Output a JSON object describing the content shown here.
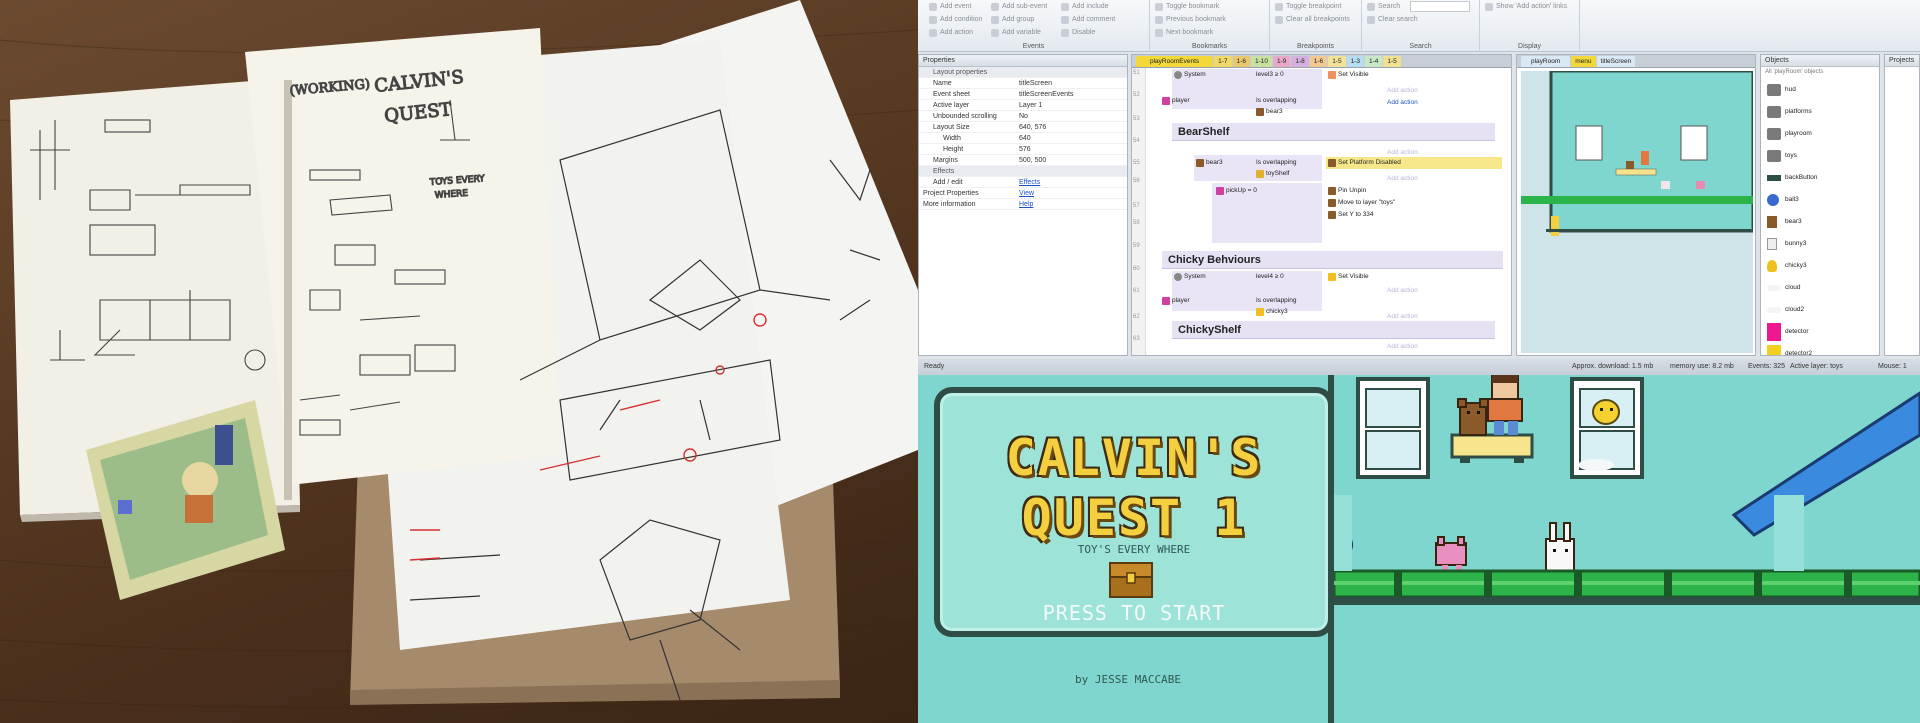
{
  "ribbon": {
    "groups": [
      {
        "label": "Events",
        "buttons": [
          "Add event",
          "Add condition",
          "Add action",
          "Add sub-event",
          "Add group",
          "Add variable",
          "Add include",
          "Add comment",
          "Disable"
        ]
      },
      {
        "label": "Bookmarks",
        "buttons": [
          "Toggle bookmark",
          "Previous bookmark",
          "Next bookmark"
        ]
      },
      {
        "label": "Breakpoints",
        "buttons": [
          "Toggle breakpoint",
          "Clear all breakpoints"
        ]
      },
      {
        "label": "Search",
        "buttons": [
          "Search",
          "Clear search"
        ]
      },
      {
        "label": "Display",
        "buttons": [
          "Show 'Add action' links"
        ]
      }
    ]
  },
  "properties": {
    "title": "Properties",
    "category_layout": "Layout properties",
    "rows": [
      {
        "k": "Name",
        "v": "titleScreen"
      },
      {
        "k": "Event sheet",
        "v": "titleScreenEvents"
      },
      {
        "k": "Active layer",
        "v": "Layer 1"
      },
      {
        "k": "Unbounded scrolling",
        "v": "No"
      },
      {
        "k": "Layout Size",
        "v": "640, 576"
      },
      {
        "k": "Width",
        "v": "640"
      },
      {
        "k": "Height",
        "v": "576"
      },
      {
        "k": "Margins",
        "v": "500, 500"
      }
    ],
    "category_effects": "Effects",
    "rows2": [
      {
        "k": "Add / edit",
        "v": "Effects"
      },
      {
        "k": "Project Properties",
        "v": "View"
      },
      {
        "k": "More information",
        "v": "Help"
      }
    ]
  },
  "events": {
    "tabs": [
      "playRoomEvents",
      "1-7",
      "1-6",
      "1-10",
      "1-9",
      "1-8",
      "1-6",
      "1-5",
      "1-3",
      "1-4",
      "1-5"
    ],
    "line_numbers": [
      "51",
      "52",
      "53",
      "54",
      "55",
      "56",
      "57",
      "58",
      "59",
      "60",
      "61",
      "62",
      "63"
    ],
    "rows": {
      "system1": "System",
      "level3": "level3 ≥ 0",
      "set_visible1": "Set Visible",
      "add_action": "Add action",
      "player1": "player",
      "overlap_bear3": "Is overlapping",
      "bear3": "bear3",
      "add_action_link": "Add action",
      "group_bearshelf": "BearShelf",
      "bear3_obj": "bear3",
      "overlap_toyshelf": "Is overlapping",
      "toyshelf": "toyShelf",
      "platform_disabled": "Set Platform Disabled",
      "pickup": "pickUp = 0",
      "pin_unpin": "Pin Unpin",
      "move_layer": "Move to layer \"toys\"",
      "set_y": "Set Y to 334",
      "group_chicky": "Chicky Behviours",
      "system2": "System",
      "level4": "level4 ≥ 0",
      "set_visible2": "Set Visible",
      "player2": "player",
      "overlap_chicky": "Is overlapping",
      "chicky3": "chicky3",
      "group_chickyshelf": "ChickyShelf"
    }
  },
  "layout_view": {
    "tabs": [
      "playRoom",
      "menu",
      "titleScreen"
    ]
  },
  "objects": {
    "title": "Objects",
    "filter": "All 'playRoom' objects",
    "items": [
      "hud",
      "platforms",
      "playroom",
      "toys",
      "backButton",
      "ball3",
      "bear3",
      "bunny3",
      "chicky3",
      "cloud",
      "cloud2",
      "detector",
      "detector2"
    ]
  },
  "projects": {
    "title": "Projects"
  },
  "status": {
    "ready": "Ready",
    "download": "Approx. download: 1.5 mb",
    "memory": "memory use: 8.2 mb",
    "events": "Events: 325",
    "active_layer": "Active layer: toys",
    "mouse": "Mouse: 1"
  },
  "game": {
    "title_line1": "CALVIN'S",
    "title_line2": "QUEST 1",
    "subtitle": "TOY'S EVERY WHERE",
    "start": "PRESS TO START",
    "byline": "by JESSE MACCABE"
  },
  "colors": {
    "game_bg": "#7fd6cf",
    "title_yellow": "#f4d040",
    "frame_dark": "#2d4d45",
    "platform_green": "#2cb34a",
    "highlight_yellow": "#f3d83a"
  }
}
